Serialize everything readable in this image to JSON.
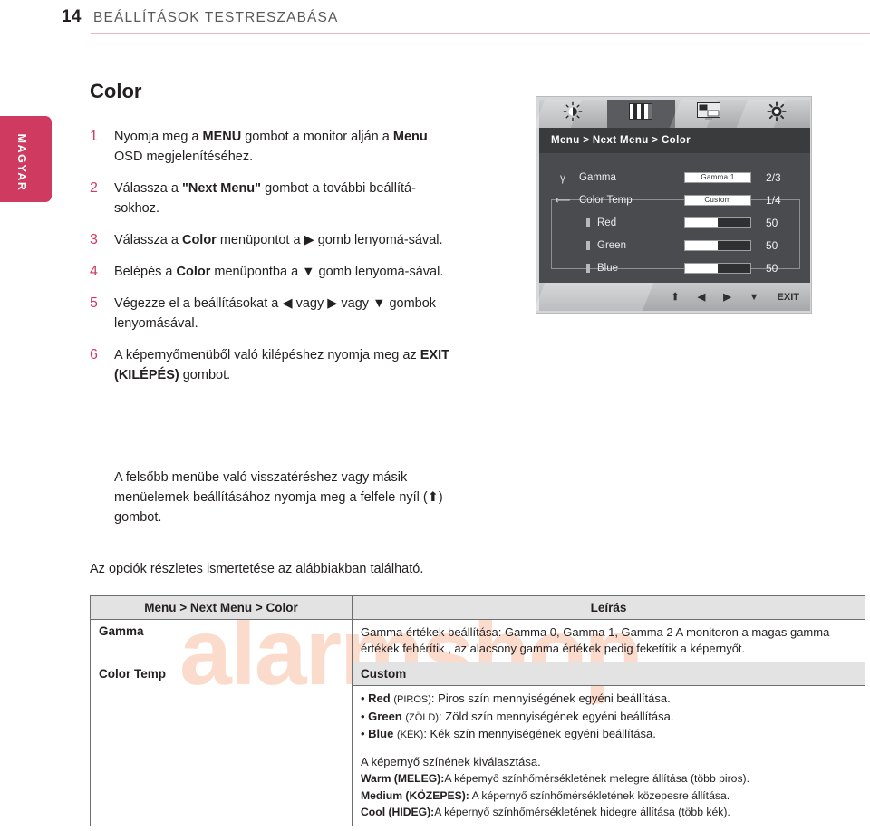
{
  "header": {
    "page_number": "14",
    "title": "BEÁLLÍTÁSOK TESTRESZABÁSA"
  },
  "language_tab": {
    "label": "MAGYAR"
  },
  "section": {
    "heading": "Color"
  },
  "steps": [
    {
      "number": "1",
      "text_html": "Nyomja meg a <b>MENU</b> gombot a monitor alján a <b>Menu</b> OSD megjelenítéséhez."
    },
    {
      "number": "2",
      "text_html": "Válassza a <b>\"Next Menu\"</b> gombot a további beállítá-sokhoz."
    },
    {
      "number": "3",
      "text_html": "Válassza a <b>Color</b> menüpontot a ▶ gomb lenyomá-sával."
    },
    {
      "number": "4",
      "text_html": "Belépés a <b>Color</b> menüpontba a ▼ gomb lenyomá-sával."
    },
    {
      "number": "5",
      "text_html": "Végezze el a beállításokat a ◀ vagy ▶ vagy ▼ gombok lenyomásával."
    },
    {
      "number": "6",
      "text_html": "A képernyőmenüből való kilépéshez nyomja meg az <b>EXIT (KILÉPÉS)</b> gombot."
    }
  ],
  "step6_note": "A felsőbb menübe való visszatéréshez vagy másik menüelemek beállításához nyomja meg a felfele nyíl (⬆) gombot.",
  "table_intro": "Az opciók részletes ismertetése az alábbiakban található.",
  "watermark": {
    "text": "alarmshop",
    "color": "#fbdccc"
  },
  "osd": {
    "icons": [
      {
        "name": "brightness-icon",
        "glyph": "☀",
        "active": false
      },
      {
        "name": "color-bars-icon",
        "glyph": "▮▮▮",
        "active": true
      },
      {
        "name": "display-icon",
        "glyph": "▭",
        "active": false
      },
      {
        "name": "setup-icon",
        "glyph": "◉",
        "active": false
      }
    ],
    "breadcrumb": "Menu  >  Next Menu  >  Color",
    "rows": [
      {
        "glyph": "γ",
        "label": "Gamma",
        "control": "box",
        "value": "Gamma 1",
        "num": "2/3"
      },
      {
        "glyph": "⟵",
        "label": "Color Temp",
        "control": "box",
        "value": "Custom",
        "num": "1/4"
      },
      {
        "glyph": "",
        "label": "Red",
        "control": "slider",
        "fill_percent": 50,
        "num": "50",
        "sub": true
      },
      {
        "glyph": "",
        "label": "Green",
        "control": "slider",
        "fill_percent": 50,
        "num": "50",
        "sub": true
      },
      {
        "glyph": "",
        "label": "Blue",
        "control": "slider",
        "fill_percent": 50,
        "num": "50",
        "sub": true
      }
    ],
    "footer_buttons": [
      {
        "name": "osd-up-button",
        "label": "⬆"
      },
      {
        "name": "osd-left-button",
        "label": "◀"
      },
      {
        "name": "osd-right-button",
        "label": "▶"
      },
      {
        "name": "osd-down-button",
        "label": "▼"
      },
      {
        "name": "osd-exit-button",
        "label": "EXIT"
      }
    ]
  },
  "options_table": {
    "headers": [
      "Menu > Next Menu > Color",
      "Leírás"
    ],
    "rows": [
      {
        "label": "Gamma",
        "description": "Gamma értékek beállítása: Gamma 0, Gamma 1, Gamma 2 A monitoron a magas gamma értékek fehérítik , az alacsony gamma értékek pedig feketítik a képernyőt."
      },
      {
        "label": "Color Temp",
        "subhead": "Custom",
        "bullets": [
          {
            "name": "Red",
            "hu": "(PIROS)",
            "desc": ": Piros szín mennyiségének egyéni beállítása."
          },
          {
            "name": "Green",
            "hu": "(ZÖLD)",
            "desc": ": Zöld szín mennyiségének egyéni beállítása."
          },
          {
            "name": "Blue",
            "hu": "(KÉK)",
            "desc": ": Kék szín mennyiségének egyéni beállítása."
          }
        ],
        "temp_intro": "A képernyő színének kiválasztása.",
        "temps": [
          {
            "name": "Warm (MELEG):",
            "desc": "A képemyő színhőmérsékletének melegre állítása (több piros)."
          },
          {
            "name": "Medium (KÖZEPES):",
            "desc": " A képernyő színhőmérsékletének közepesre állítása."
          },
          {
            "name": "Cool (HIDEG):",
            "desc": "A képernyő színhőmérsékletének hidegre állítása (több kék)."
          }
        ]
      }
    ]
  }
}
